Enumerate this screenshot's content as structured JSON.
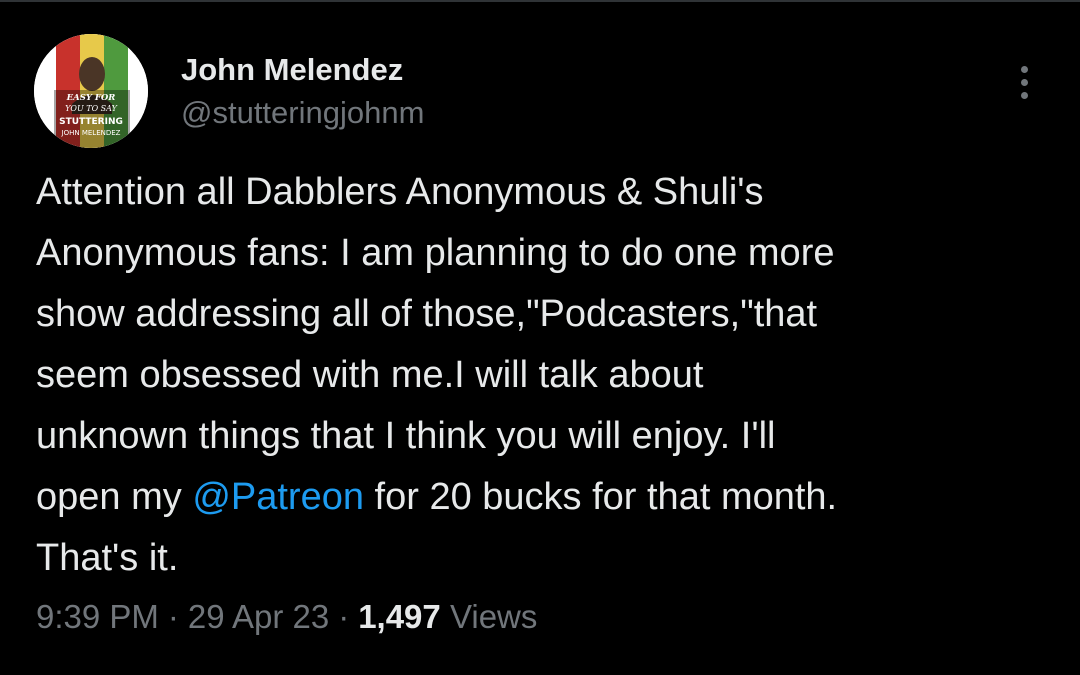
{
  "author": {
    "display_name": "John Melendez",
    "handle": "@stutteringjohnm",
    "avatar_lines": [
      "EASY FOR",
      "YOU TO SAY",
      "STUTTERING",
      "JOHN MELENDEZ"
    ]
  },
  "tweet": {
    "lines": [
      {
        "parts": [
          "Attention all Dabblers Anonymous & Shuli's"
        ]
      },
      {
        "parts": [
          "Anonymous fans: I am planning to do one more"
        ]
      },
      {
        "parts": [
          "show addressing all of those,\"Podcasters,\"that"
        ]
      },
      {
        "parts": [
          "seem obsessed with me.I will talk about"
        ]
      },
      {
        "parts": [
          "unknown things that I think you will enjoy. I'll"
        ]
      },
      {
        "before": "open my ",
        "mention": "@Patreon",
        "after": " for 20 bucks for that month."
      },
      {
        "parts": [
          "That's it."
        ]
      }
    ]
  },
  "meta": {
    "time": "9:39 PM",
    "separator": "·",
    "date": "29 Apr 23",
    "views_count": "1,497",
    "views_label": "Views"
  },
  "colors": {
    "background": "#000000",
    "text": "#e7e9ea",
    "secondary": "#71767b",
    "link": "#1d9bf0"
  },
  "icons": {
    "more": "more-vertical-icon"
  }
}
